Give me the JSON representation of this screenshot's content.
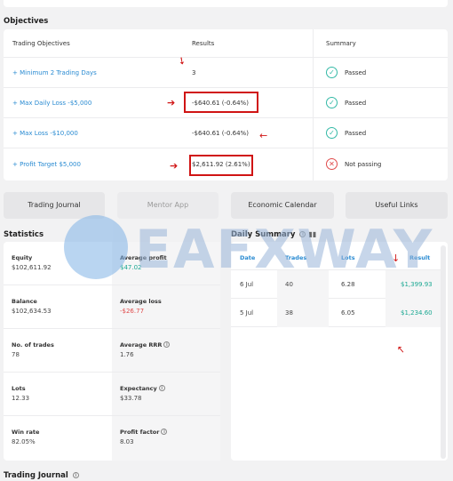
{
  "objectives": {
    "title": "Objectives",
    "headers": {
      "objective": "Trading Objectives",
      "results": "Results",
      "summary": "Summary"
    },
    "rows": [
      {
        "objective": "+ Minimum 2 Trading Days",
        "result": "3",
        "summary": "Passed",
        "status": "passed"
      },
      {
        "objective": "+ Max Daily Loss -$5,000",
        "result": "-$640.61 (-0.64%)",
        "summary": "Passed",
        "status": "passed"
      },
      {
        "objective": "+ Max Loss -$10,000",
        "result": "-$640.61 (-0.64%)",
        "summary": "Passed",
        "status": "passed"
      },
      {
        "objective": "+ Profit Target $5,000",
        "result": "$2,611.92 (2.61%)",
        "summary": "Not passing",
        "status": "failed"
      }
    ]
  },
  "tabs": [
    {
      "label": "Trading Journal"
    },
    {
      "label": "Mentor App"
    },
    {
      "label": "Economic Calendar"
    },
    {
      "label": "Useful Links"
    }
  ],
  "statistics": {
    "title": "Statistics",
    "cells": [
      {
        "label": "Equity",
        "value": "$102,611.92"
      },
      {
        "label": "Average profit",
        "value": "$47.02"
      },
      {
        "label": "Balance",
        "value": "$102,634.53"
      },
      {
        "label": "Average loss",
        "value": "-$26.77"
      },
      {
        "label": "No. of trades",
        "value": "78"
      },
      {
        "label": "Average RRR",
        "value": "1.76"
      },
      {
        "label": "Lots",
        "value": "12.33"
      },
      {
        "label": "Expectancy",
        "value": "$33.78"
      },
      {
        "label": "Win rate",
        "value": "82.05%"
      },
      {
        "label": "Profit factor",
        "value": "8.03"
      }
    ]
  },
  "daily_summary": {
    "title": "Daily Summary",
    "headers": {
      "date": "Date",
      "trades": "Trades",
      "lots": "Lots",
      "result": "Result"
    },
    "rows": [
      {
        "date": "6 Jul",
        "trades": "40",
        "lots": "6.28",
        "result": "$1,399.93"
      },
      {
        "date": "5 Jul",
        "trades": "38",
        "lots": "6.05",
        "result": "$1,234.60"
      }
    ]
  },
  "watermark": {
    "text": "EAFXWAY"
  },
  "journal_section": {
    "title": "Trading Journal"
  },
  "colors": {
    "accent": "#2a8bd2",
    "positive": "#1aa892",
    "negative": "#e04a4a",
    "annotation": "#d01414"
  }
}
